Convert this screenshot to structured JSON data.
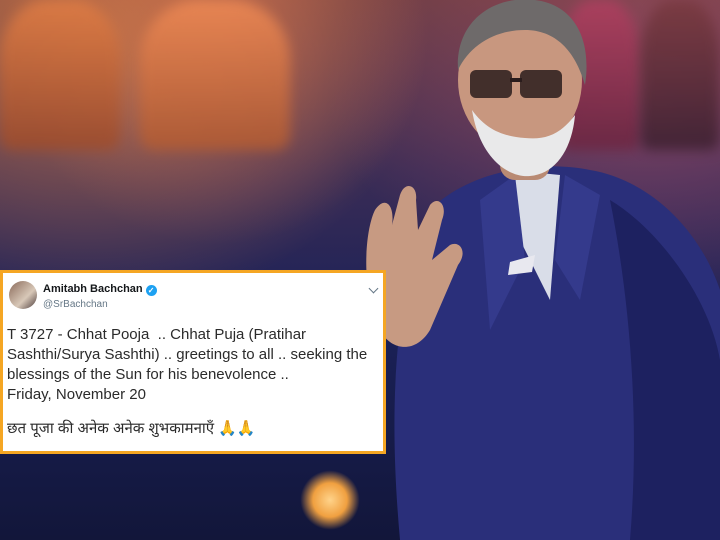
{
  "tweet": {
    "name": "Amitabh Bachchan",
    "handle": "@SrBachchan",
    "lines": [
      "T 3727 - Chhat Pooja  .. Chhat Puja (Pratihar",
      "Sashthi/Surya Sashthi) .. greetings to all .. seeking the",
      "blessings of the Sun for his benevolence .."
    ],
    "date": "Friday, November 20",
    "hindi": "छत पूजा की अनेक अनेक शुभकामनाएँ 🙏🙏"
  },
  "colors": {
    "highlight_border": "#f5a623",
    "verified": "#1da1f2",
    "suit": "#2a2f7a"
  },
  "icons": [
    "verified-badge-icon",
    "chevron-down-icon"
  ]
}
